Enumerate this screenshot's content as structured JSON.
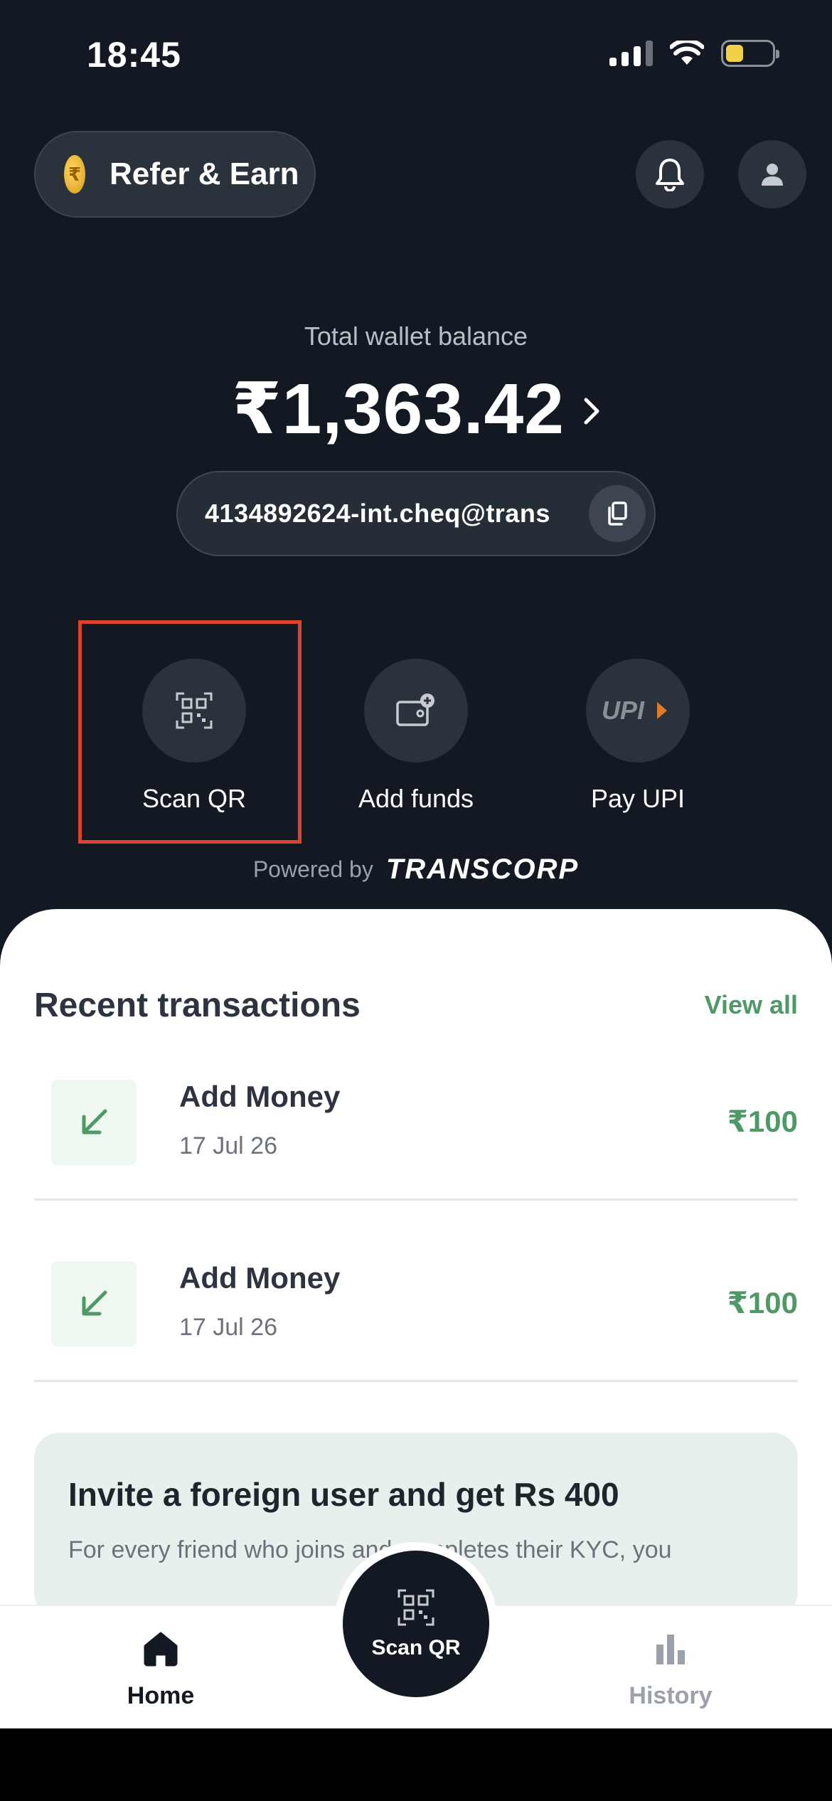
{
  "status_bar": {
    "time": "18:45"
  },
  "header": {
    "refer_label": "Refer & Earn",
    "coin_symbol": "₹"
  },
  "wallet": {
    "caption": "Total wallet balance",
    "amount": "₹1,363.42",
    "upi_id": "4134892624-int.cheq@trans"
  },
  "actions": [
    {
      "label": "Scan QR",
      "icon": "qr-scan-icon"
    },
    {
      "label": "Add funds",
      "icon": "wallet-add-icon"
    },
    {
      "label": "Pay UPI",
      "icon": "upi-logo"
    }
  ],
  "powered": {
    "text": "Powered by",
    "brand": "TRANSCORP"
  },
  "recent": {
    "title": "Recent transactions",
    "view_all": "View all",
    "items": [
      {
        "title": "Add Money",
        "date": "17 Jul 26",
        "amount": "₹100"
      },
      {
        "title": "Add Money",
        "date": "17 Jul 26",
        "amount": "₹100"
      }
    ]
  },
  "invite": {
    "title": "Invite a foreign user and get Rs 400",
    "body": "For every friend who joins and completes their KYC, you"
  },
  "bottom_nav": {
    "home": "Home",
    "scan": "Scan QR",
    "history": "History"
  },
  "colors": {
    "background": "#131922",
    "accent_green": "#4f9967",
    "highlight": "#e0432b"
  }
}
